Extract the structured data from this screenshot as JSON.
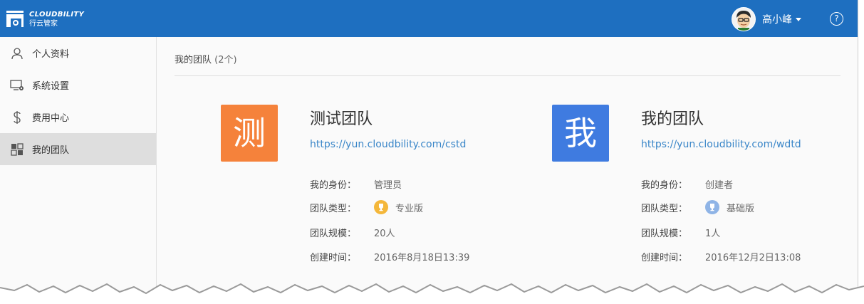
{
  "app": {
    "logo_en": "CLOUDBILITY",
    "logo_cn": "行云管家"
  },
  "header": {
    "user_name": "高小峰",
    "help_glyph": "?"
  },
  "sidebar": {
    "items": [
      {
        "label": "个人资料",
        "icon": "user-icon"
      },
      {
        "label": "系统设置",
        "icon": "monitor-settings-icon"
      },
      {
        "label": "费用中心",
        "icon": "dollar-icon"
      },
      {
        "label": "我的团队",
        "icon": "team-grid-icon",
        "active": true
      }
    ]
  },
  "main": {
    "title": "我的团队",
    "count": "(2个)",
    "teams": [
      {
        "tile_char": "测",
        "tile_color": "#f5823b",
        "name": "测试团队",
        "url": "https://yun.cloudbility.com/cstd",
        "role_label": "我的身份：",
        "role": "管理员",
        "type_label": "团队类型：",
        "type": "专业版",
        "type_badge": "gold-trophy-icon",
        "size_label": "团队规模：",
        "size": "20人",
        "created_label": "创建时间：",
        "created": "2016年8月18日13:39"
      },
      {
        "tile_char": "我",
        "tile_color": "#3f7be0",
        "name": "我的团队",
        "url": "https://yun.cloudbility.com/wdtd",
        "role_label": "我的身份：",
        "role": "创建者",
        "type_label": "团队类型：",
        "type": "基础版",
        "type_badge": "blue-trophy-icon",
        "size_label": "团队规模：",
        "size": "1人",
        "created_label": "创建时间：",
        "created": "2016年12月2日13:08"
      }
    ]
  },
  "colors": {
    "topbar": "#1e6fc0",
    "link": "#3a86c8",
    "gold_badge": "#f4b73a",
    "blue_badge": "#8fb4e6"
  }
}
